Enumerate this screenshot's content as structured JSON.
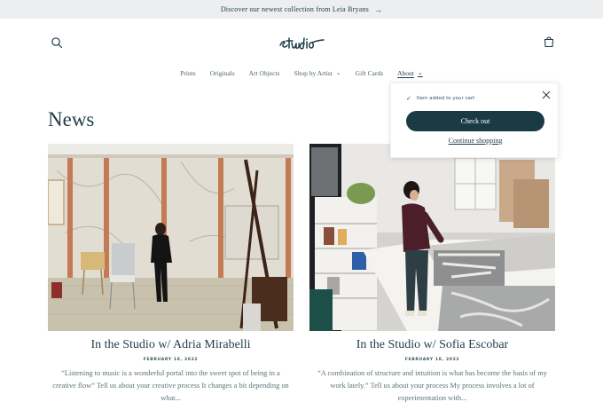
{
  "announcement": {
    "text": "Discover our newest collection from Leia Bryans",
    "arrow": "→"
  },
  "header": {
    "logo_text": "Studio",
    "search_icon": "search-icon",
    "cart_icon": "cart-icon"
  },
  "nav": {
    "items": [
      {
        "label": "Prints"
      },
      {
        "label": "Originals"
      },
      {
        "label": "Art Objects"
      },
      {
        "label": "Shop by Artist",
        "dropdown": "⌄"
      },
      {
        "label": "Gift Cards"
      },
      {
        "label": "About",
        "dropdown": "⌄"
      }
    ]
  },
  "page": {
    "title": "News"
  },
  "posts": [
    {
      "title": "In the Studio w/ Adria Mirabelli",
      "date": "FEBRUARY 18, 2022",
      "excerpt": "“Listening to music is a wonderful portal into the sweet spot of being in a creative flow” Tell us about your creative process It changes a bit depending on what..."
    },
    {
      "title": "In the Studio w/ Sofia Escobar",
      "date": "FEBRUARY 18, 2022",
      "excerpt": "“A combination of structure and intuition is what has become the basis of my work lately.” Tell us about your process My process involves a lot of experimentation with..."
    }
  ],
  "cart_popup": {
    "message": "Item added to your cart",
    "check": "✓",
    "checkout_label": "Check out",
    "continue_label": "Continue shopping"
  },
  "colors": {
    "brand_dark": "#1a3a44",
    "announcement_bg": "#eceef0",
    "text": "#1f3d47"
  }
}
